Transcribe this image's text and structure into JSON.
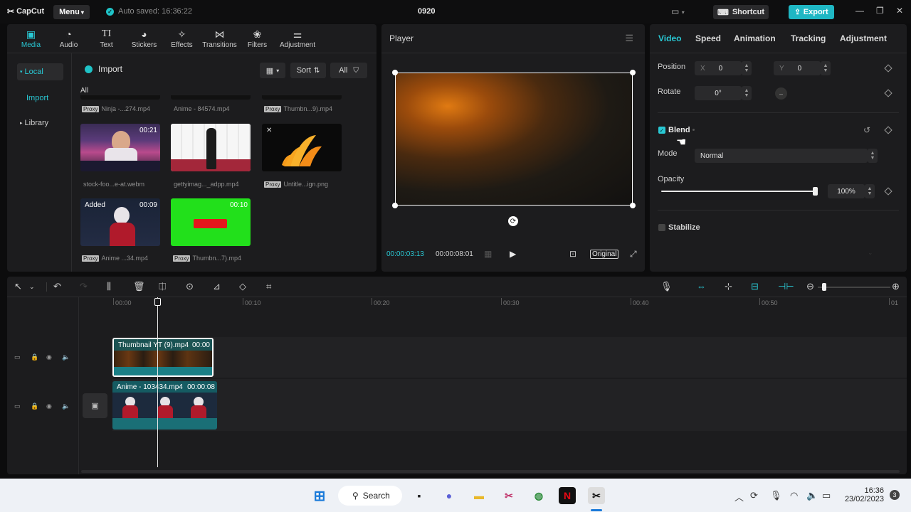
{
  "titlebar": {
    "app_name": "CapCut",
    "menu_label": "Menu",
    "autosave_text": "Auto saved: 16:36:22",
    "project_title": "0920",
    "shortcut_label": "Shortcut",
    "export_label": "Export"
  },
  "media_toolbar": {
    "items": [
      {
        "label": "Media",
        "icon": "media-icon"
      },
      {
        "label": "Audio",
        "icon": "audio-icon"
      },
      {
        "label": "Text",
        "icon": "text-icon"
      },
      {
        "label": "Stickers",
        "icon": "stickers-icon"
      },
      {
        "label": "Effects",
        "icon": "effects-icon"
      },
      {
        "label": "Transitions",
        "icon": "transitions-icon"
      },
      {
        "label": "Filters",
        "icon": "filters-icon"
      },
      {
        "label": "Adjustment",
        "icon": "adjustment-icon"
      }
    ]
  },
  "media_sidebar": {
    "local": "Local",
    "import": "Import",
    "library": "Library"
  },
  "media_main": {
    "import_label": "Import",
    "sort_label": "Sort",
    "all_filter": "All",
    "section_label": "All",
    "proxy_tag": "Proxy",
    "top_captions": [
      "Ninja -...274.mp4",
      "Anime - 84574.mp4",
      "Thumbn...9).mp4"
    ],
    "items": [
      {
        "name": "stock-foo...e-at.webm",
        "duration": "00:21",
        "proxy": false
      },
      {
        "name": "gettyimag..._adpp.mp4",
        "duration": "",
        "proxy": false
      },
      {
        "name": "Untitle...ign.png",
        "duration": "",
        "proxy": true
      },
      {
        "name": "Anime ...34.mp4",
        "duration": "00:09",
        "added": "Added",
        "proxy": true
      },
      {
        "name": "Thumbn...7).mp4",
        "duration": "00:10",
        "proxy": true
      }
    ]
  },
  "player": {
    "title": "Player",
    "current_time": "00:00:03:13",
    "total_time": "00:00:08:01",
    "ratio_label": "Original"
  },
  "properties": {
    "tabs": [
      "Video",
      "Speed",
      "Animation",
      "Tracking",
      "Adjustment"
    ],
    "position_label": "Position",
    "x_label": "X",
    "x_value": "0",
    "y_label": "Y",
    "y_value": "0",
    "rotate_label": "Rotate",
    "rotate_value": "0°",
    "blend_label": "Blend",
    "mode_label": "Mode",
    "mode_value": "Normal",
    "opacity_label": "Opacity",
    "opacity_value": "100%",
    "opacity_level": 1.0,
    "stabilize_label": "Stabilize"
  },
  "timeline": {
    "ruler": [
      "00:00",
      "00:10",
      "00:20",
      "00:30",
      "00:40",
      "00:50",
      "01"
    ],
    "clips": [
      {
        "label": "Thumbnail YT (9).mp4",
        "duration": "00:00"
      },
      {
        "label": "Anime - 103434.mp4",
        "duration": "00:00:08"
      }
    ]
  },
  "taskbar": {
    "search_label": "Search",
    "time": "16:36",
    "date": "23/02/2023",
    "notification_count": "3"
  },
  "colors": {
    "accent": "#29c8d4",
    "export_bg": "#1fb7c4",
    "panel_bg": "#1c1c1e",
    "window_bg": "#0c0c0d",
    "green_screen": "#22e01b"
  }
}
